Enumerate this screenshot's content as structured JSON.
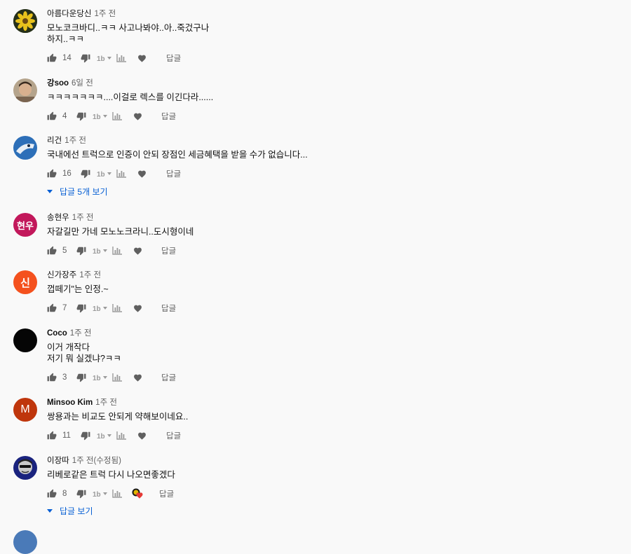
{
  "comments": [
    {
      "author": "아름다운당신",
      "time": "1주 전",
      "text": "모노코크바디..ㅋㅋ 사고나봐야..아..죽겄구나\n하지..ㅋㅋ",
      "likes": "14",
      "reply": "답글"
    },
    {
      "author": "강soo",
      "time": "6일 전",
      "text": "ㅋㅋㅋㅋㅋㅋㅋ....이걸로 렉스를 이긴다라......",
      "likes": "4",
      "reply": "답글"
    },
    {
      "author": "리건",
      "time": "1주 전",
      "text": "국내에선 트럭으로 인증이 안되 장점인 세금혜택을 받을 수가 없습니다...",
      "likes": "16",
      "reply": "답글",
      "replies": "답글 5개 보기"
    },
    {
      "author": "송현우",
      "time": "1주 전",
      "text": "자갈길만 가네 모노노크라니..도시형이네",
      "likes": "5",
      "reply": "답글",
      "avatar_text": "현우"
    },
    {
      "author": "신가장주",
      "time": "1주 전",
      "text": "껍떼기\"는 인정.~",
      "likes": "7",
      "reply": "답글",
      "avatar_text": "신"
    },
    {
      "author": "Coco",
      "time": "1주 전",
      "text": "이거 개작다\n저기 뭐 실겠냐?ㅋㅋ",
      "likes": "3",
      "reply": "답글"
    },
    {
      "author": "Minsoo Kim",
      "time": "1주 전",
      "text": "쌍용과는 비교도 안되게 약해보이네요..",
      "likes": "11",
      "reply": "답글",
      "avatar_text": "M"
    },
    {
      "author": "이장따",
      "time": "1주 전(수정됨)",
      "text": "리베로같은 트럭 다시 나오면좋겠다",
      "likes": "8",
      "reply": "답글",
      "replies": "답글 보기"
    }
  ],
  "colors": {
    "link": "#065fd4",
    "icon": "#606060",
    "heart_creator": "#e53935"
  },
  "icons": [
    "thumb-up-icon",
    "thumb-down-icon",
    "dislike-text-icon",
    "caret-icon",
    "bar-chart-icon",
    "heart-icon",
    "chevron-down-icon",
    "creator-heart-icon"
  ]
}
